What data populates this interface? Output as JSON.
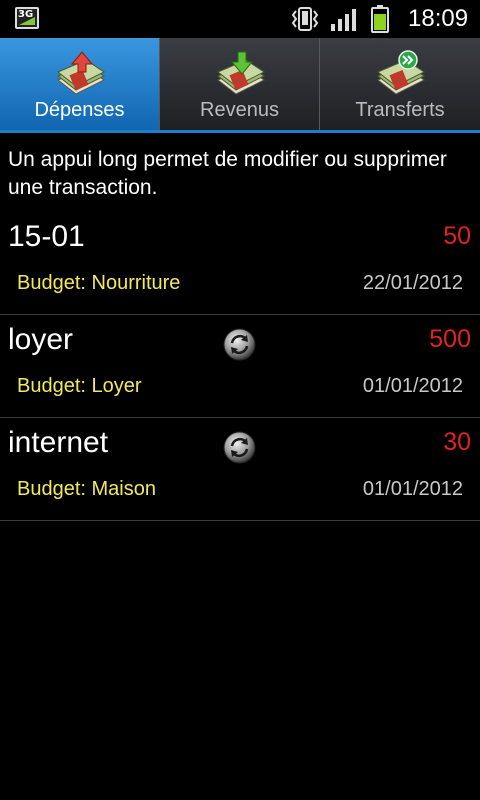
{
  "status_bar": {
    "network": "3G",
    "time": "18:09"
  },
  "tabs": [
    {
      "label": "Dépenses",
      "active": true,
      "icon": "money-up-icon"
    },
    {
      "label": "Revenus",
      "active": false,
      "icon": "money-down-icon"
    },
    {
      "label": "Transferts",
      "active": false,
      "icon": "money-transfer-icon"
    }
  ],
  "hint": "Un appui long permet de modifier ou supprimer une transaction.",
  "transactions": [
    {
      "name": "15-01",
      "amount": "50",
      "budget": "Budget: Nourriture",
      "date": "22/01/2012",
      "recurring": false
    },
    {
      "name": "loyer",
      "amount": "500",
      "budget": "Budget: Loyer",
      "date": "01/01/2012",
      "recurring": true
    },
    {
      "name": "internet",
      "amount": "30",
      "budget": "Budget: Maison",
      "date": "01/01/2012",
      "recurring": true
    }
  ],
  "colors": {
    "tab_active": "#1a79c8",
    "amount": "#e02222",
    "budget": "#f3e95a"
  }
}
